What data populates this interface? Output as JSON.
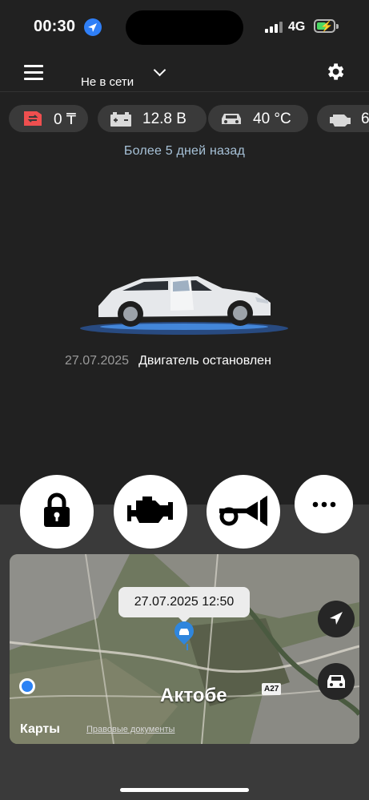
{
  "status_bar": {
    "time": "00:30",
    "network": "4G"
  },
  "header": {
    "title": "Не в сети"
  },
  "chips": [
    {
      "icon": "balance-icon",
      "value": "0 ₸",
      "accent": "#ef4f4f"
    },
    {
      "icon": "battery-icon",
      "value": "12.8 В"
    },
    {
      "icon": "car-temperature-icon",
      "value": "40 °C"
    },
    {
      "icon": "engine-icon",
      "value": "6"
    }
  ],
  "last_seen": "Более 5 дней назад",
  "status": {
    "date": "27.07.2025",
    "engine": "Двигатель остановлен"
  },
  "actions": [
    {
      "name": "lock-button",
      "icon": "lock-icon"
    },
    {
      "name": "engine-start-button",
      "icon": "engine-icon"
    },
    {
      "name": "horn-button",
      "icon": "horn-icon"
    },
    {
      "name": "more-button",
      "icon": "ellipsis-icon"
    }
  ],
  "map": {
    "callout": "27.07.2025 12:50",
    "city": "Актобе",
    "road": "A27",
    "brand": "Карты",
    "legal": "Правовые документы"
  }
}
